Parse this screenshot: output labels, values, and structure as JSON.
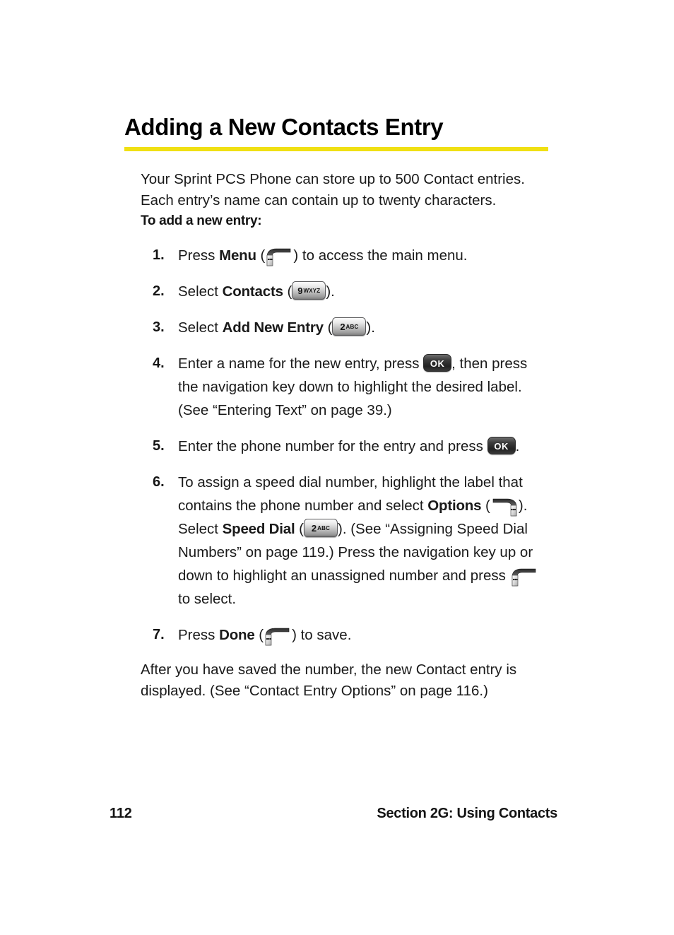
{
  "document": {
    "title": "Adding a New Contacts Entry",
    "accent_color": "#f0e013",
    "text_color": "#1a1a1a",
    "lead_paragraph": "Your Sprint PCS Phone can store up to 500 Contact entries. Each entry’s name can contain up to twenty characters.",
    "subhead": "To add a new entry:",
    "closing_paragraph": "After you have saved the number, the new Contact entry is displayed. (See “Contact Entry Options” on page 116.)"
  },
  "steps": [
    {
      "number": "1.",
      "text_before": "Press ",
      "term": "Menu",
      "text_mid": " (",
      "icon": "left-softkey-icon",
      "text_after": ") to access the main menu."
    },
    {
      "number": "2.",
      "text_before": "Select ",
      "term": "Contacts",
      "text_mid": " (",
      "icon": "key-9-wxyz-icon",
      "key_digit": "9",
      "key_letters": "WXYZ",
      "text_after": ")."
    },
    {
      "number": "3.",
      "text_before": "Select ",
      "term": "Add New Entry",
      "text_mid": " (",
      "icon": "key-2-abc-icon",
      "key_digit": "2",
      "key_letters": "ABC",
      "text_after": ")."
    },
    {
      "number": "4.",
      "text_before": "Enter a name for the new entry, press ",
      "icon": "ok-key-icon",
      "ok_label": "OK",
      "text_after": ", then press the navigation key down to highlight the desired label. (See “Entering Text” on page 39.)"
    },
    {
      "number": "5.",
      "text_before": "Enter the phone number for the entry and press ",
      "icon": "ok-key-icon",
      "ok_label": "OK",
      "text_after": "."
    },
    {
      "number": "6.",
      "line1_before": "To assign a speed dial number, highlight the label that contains the phone number and select ",
      "line1_term": "Options",
      "line1_mid": " (",
      "line1_icon": "right-softkey-icon",
      "line1_after": ").",
      "line2_before": "Select ",
      "line2_term": "Speed Dial",
      "line2_mid": " (",
      "line2_icon": "key-2-abc-icon",
      "key_digit": "2",
      "key_letters": "ABC",
      "line2_after": "). (See “Assigning Speed Dial Numbers” on page 119.) Press the navigation key up or down to highlight an unassigned number and press ",
      "line3_icon": "left-softkey-icon",
      "line3_after": " to select."
    },
    {
      "number": "7.",
      "text_before": "Press ",
      "term": "Done",
      "text_mid": " (",
      "icon": "left-softkey-icon",
      "text_after": ") to save."
    }
  ],
  "footer": {
    "page_number": "112",
    "section_label": "Section 2G: Using Contacts"
  }
}
